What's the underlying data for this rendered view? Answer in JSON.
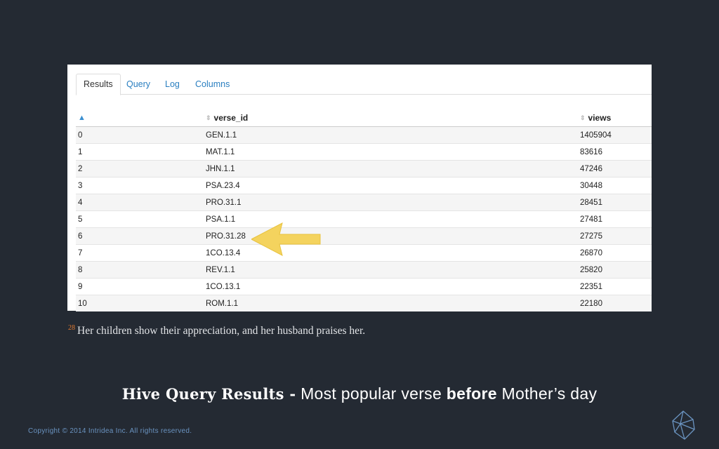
{
  "tabs": [
    {
      "label": "Results",
      "active": true
    },
    {
      "label": "Query",
      "active": false
    },
    {
      "label": "Log",
      "active": false
    },
    {
      "label": "Columns",
      "active": false
    }
  ],
  "table": {
    "columns": [
      "",
      "verse_id",
      "views"
    ],
    "rows": [
      [
        "0",
        "GEN.1.1",
        "1405904"
      ],
      [
        "1",
        "MAT.1.1",
        "83616"
      ],
      [
        "2",
        "JHN.1.1",
        "47246"
      ],
      [
        "3",
        "PSA.23.4",
        "30448"
      ],
      [
        "4",
        "PRO.31.1",
        "28451"
      ],
      [
        "5",
        "PSA.1.1",
        "27481"
      ],
      [
        "6",
        "PRO.31.28",
        "27275"
      ],
      [
        "7",
        "1CO.13.4",
        "26870"
      ],
      [
        "8",
        "REV.1.1",
        "25820"
      ],
      [
        "9",
        "1CO.13.1",
        "22351"
      ],
      [
        "10",
        "ROM.1.1",
        "22180"
      ]
    ]
  },
  "highlight": {
    "row_index": 6,
    "icon": "arrow-left-icon",
    "color": "#f4d35e"
  },
  "footnote": {
    "number": "28",
    "text": "Her children show their appreciation, and her husband praises her."
  },
  "caption": {
    "bold": "Hive Query Results -",
    "part1": " Most popular verse ",
    "emphasis": "before",
    "part2": " Mother’s day"
  },
  "copyright": "Copyright © 2014 Intridea Inc. All rights reserved.",
  "logo_icon": "polyhedron-logo-icon",
  "colors": {
    "background": "#242a33",
    "accent": "#2a7fc0",
    "footnote_number": "#e37a30"
  }
}
